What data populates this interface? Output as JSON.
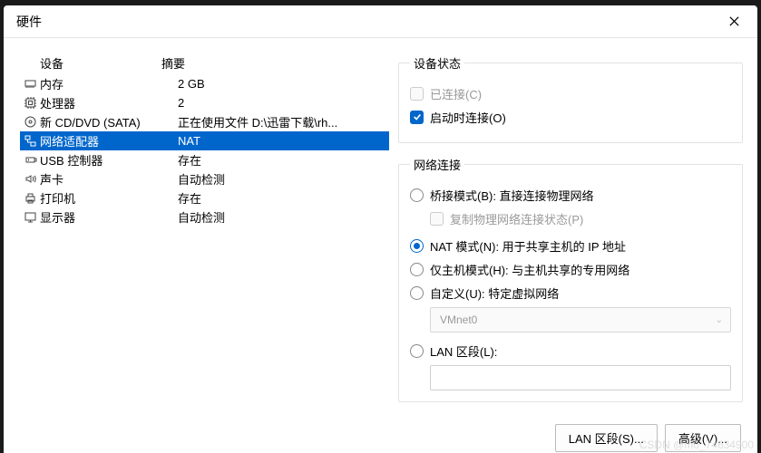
{
  "window": {
    "title": "硬件"
  },
  "headers": {
    "device": "设备",
    "summary": "摘要"
  },
  "devices": [
    {
      "icon": "memory-icon",
      "name": "内存",
      "summary": "2 GB",
      "selected": false
    },
    {
      "icon": "cpu-icon",
      "name": "处理器",
      "summary": "2",
      "selected": false
    },
    {
      "icon": "disc-icon",
      "name": "新 CD/DVD (SATA)",
      "summary": "正在使用文件 D:\\迅雷下载\\rh...",
      "selected": false
    },
    {
      "icon": "network-icon",
      "name": "网络适配器",
      "summary": "NAT",
      "selected": true
    },
    {
      "icon": "usb-icon",
      "name": "USB 控制器",
      "summary": "存在",
      "selected": false
    },
    {
      "icon": "sound-icon",
      "name": "声卡",
      "summary": "自动检测",
      "selected": false
    },
    {
      "icon": "printer-icon",
      "name": "打印机",
      "summary": "存在",
      "selected": false
    },
    {
      "icon": "display-icon",
      "name": "显示器",
      "summary": "自动检测",
      "selected": false
    }
  ],
  "sections": {
    "deviceStatus": {
      "legend": "设备状态",
      "connected": "已连接(C)",
      "connectOnStart": "启动时连接(O)"
    },
    "netConn": {
      "legend": "网络连接",
      "bridged": "桥接模式(B): 直接连接物理网络",
      "copyPhys": "复制物理网络连接状态(P)",
      "nat": "NAT 模式(N): 用于共享主机的 IP 地址",
      "hostOnly": "仅主机模式(H): 与主机共享的专用网络",
      "custom": "自定义(U): 特定虚拟网络",
      "vmnet": "VMnet0",
      "lanSeg": "LAN 区段(L):"
    }
  },
  "buttons": {
    "lanSegments": "LAN 区段(S)...",
    "advanced": "高级(V)..."
  },
  "watermark": "CSDN @m0_74634900"
}
